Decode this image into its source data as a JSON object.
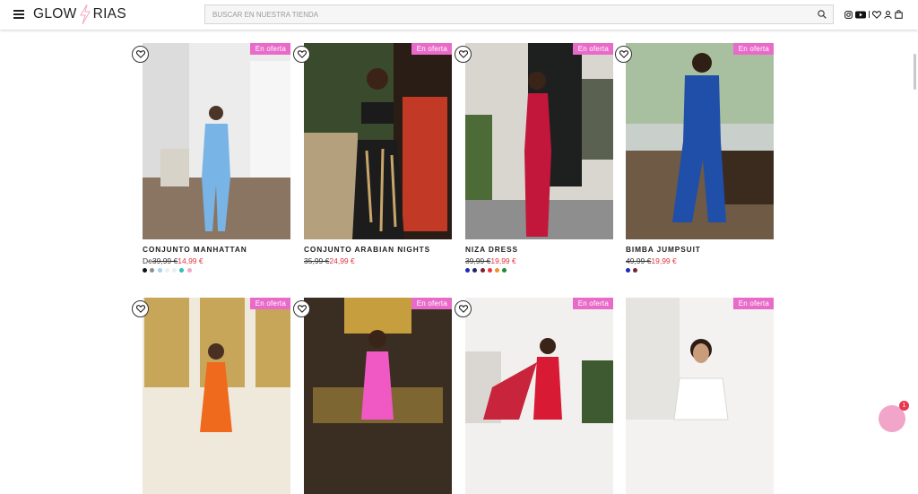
{
  "header": {
    "logo_left": "GLOW",
    "logo_right": "RIAS",
    "search_placeholder": "BUSCAR EN NUESTRA TIENDA"
  },
  "badge_label": "En oferta",
  "products_row1": [
    {
      "name": "CONJUNTO MANHATTAN",
      "prefix": "De",
      "old_price": "39,99 €",
      "new_price": "14,99 €",
      "swatches": [
        "#111111",
        "#8a8f94",
        "#9fd3f0",
        "#e9f0f4",
        "#eeeeee",
        "#2bc2b8",
        "#f0a8c4"
      ]
    },
    {
      "name": "CONJUNTO ARABIAN NIGHTS",
      "prefix": "",
      "old_price": "35,99 €",
      "new_price": "24,99 €",
      "swatches": []
    },
    {
      "name": "NIZA DRESS",
      "prefix": "",
      "old_price": "39,99 €",
      "new_price": "19,99 €",
      "swatches": [
        "#1c2bb5",
        "#1e2a5a",
        "#7a2233",
        "#e8353b",
        "#f0922b",
        "#1e8a3a"
      ]
    },
    {
      "name": "BIMBA JUMPSUIT",
      "prefix": "",
      "old_price": "49,99 €",
      "new_price": "19,99 €",
      "swatches": [
        "#1c2bb5",
        "#7a2233"
      ]
    }
  ],
  "chat_badge_count": "1",
  "colors": {
    "sale_badge": "#e96bc9",
    "sale_price": "#e0343d"
  }
}
